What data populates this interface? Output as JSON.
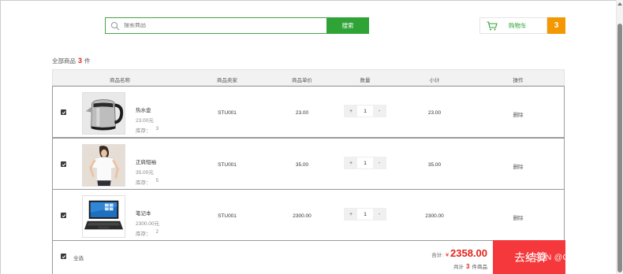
{
  "search": {
    "placeholder": "搜索商品",
    "value": "",
    "button_label": "搜索",
    "icon": "search-icon"
  },
  "cart": {
    "label": "购物车",
    "count": "3",
    "icon": "cart-icon"
  },
  "summary": {
    "prefix": "全部商品",
    "count": "3",
    "suffix": "件"
  },
  "table": {
    "headers": [
      "商品名称",
      "商品卖家",
      "商品单价",
      "数量",
      "小计",
      "操作"
    ],
    "rows": [
      {
        "name": "热水壶",
        "price": "23.00元",
        "stock_label": "库存：",
        "stock": "3",
        "seller": "STU001",
        "unit_price": "23.00",
        "qty": "1",
        "subtotal": "23.00",
        "action": "删除",
        "checked": true,
        "image": "kettle"
      },
      {
        "name": "正肩短袖",
        "price": "35.00元",
        "stock_label": "库存：",
        "stock": "5",
        "seller": "STU001",
        "unit_price": "35.00",
        "qty": "1",
        "subtotal": "35.00",
        "action": "删除",
        "checked": true,
        "image": "tshirt"
      },
      {
        "name": "笔记本",
        "price": "2300.00元",
        "stock_label": "库存：",
        "stock": "2",
        "seller": "STU001",
        "unit_price": "2300.00",
        "qty": "1",
        "subtotal": "2300.00",
        "action": "删除",
        "checked": true,
        "image": "laptop"
      }
    ],
    "qty_plus": "+",
    "qty_minus": "-"
  },
  "footer": {
    "select_all": "全选",
    "total_label": "合计:",
    "currency": "¥",
    "total": "2358.00",
    "count_prefix": "共计",
    "count": "3",
    "count_suffix": "件商品",
    "checkout_label": "去结算"
  },
  "watermark": "CSDN @Coder-coco",
  "colors": {
    "accent_green": "#2fa336",
    "cart_badge": "#f39800",
    "price_red": "#e2231a",
    "checkout_red": "#f5383b"
  }
}
